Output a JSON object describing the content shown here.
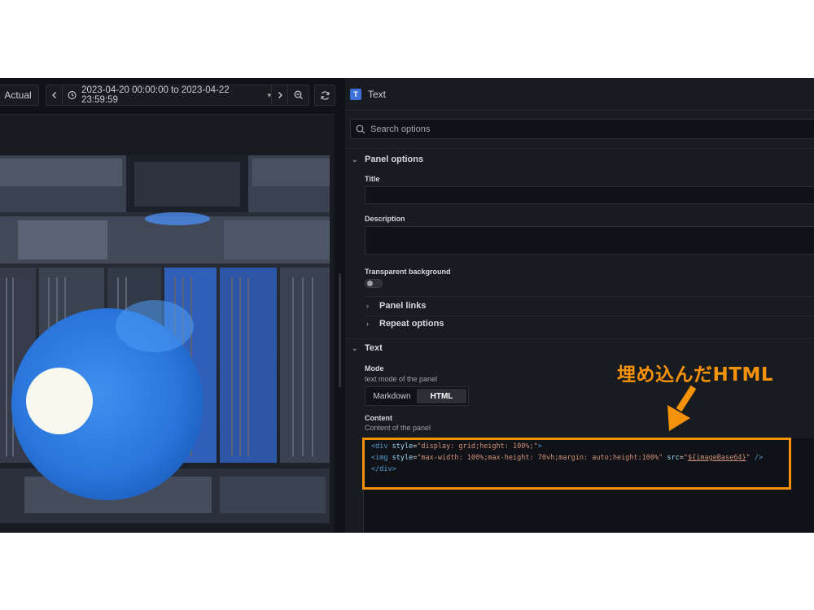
{
  "toolbar": {
    "actual_label": "Actual",
    "time_range": "2023-04-20 00:00:00 to 2023-04-22 23:59:59",
    "icons": [
      "chevron-left-icon",
      "clock-icon",
      "chevron-down-icon",
      "chevron-right-icon",
      "zoom-out-icon",
      "refresh-icon"
    ]
  },
  "options_pane": {
    "viz_name": "Text",
    "viz_icon_letter": "T",
    "search_placeholder": "Search options",
    "panel_options": {
      "section_title": "Panel options",
      "title_label": "Title",
      "title_value": "",
      "description_label": "Description",
      "description_value": "",
      "transparent_label": "Transparent background",
      "transparent_enabled": false,
      "panel_links_label": "Panel links",
      "repeat_options_label": "Repeat options"
    },
    "text": {
      "section_title": "Text",
      "mode_label": "Mode",
      "mode_description": "text mode of the panel",
      "modes": [
        "Markdown",
        "HTML"
      ],
      "selected_mode": "HTML",
      "content_label": "Content",
      "content_description": "Content of the panel"
    }
  },
  "code": {
    "l1": {
      "lt": "<div ",
      "attr": "style",
      "eq": "=",
      "val": "\"display: grid;height: 100%;\"",
      "close": ">"
    },
    "l2": {
      "lt": "<img ",
      "a1": "style",
      "eq1": "=",
      "v1": "\"max-width: 100%;max-height: 70vh;margin: auto;height:100%\"",
      "a2": " src",
      "eq2": "=",
      "q1": "\"",
      "tpl": "${imageBase64}",
      "q2": "\"",
      "close": " />"
    },
    "l3": {
      "lt": "</div>"
    }
  },
  "annotation": {
    "text": "埋め込んだHTML",
    "color": "#f5920c"
  },
  "colors": {
    "background": "#111217",
    "panel": "#181b1f",
    "accent_blue": "#3d71d9",
    "annotation_orange": "#f5920c"
  }
}
